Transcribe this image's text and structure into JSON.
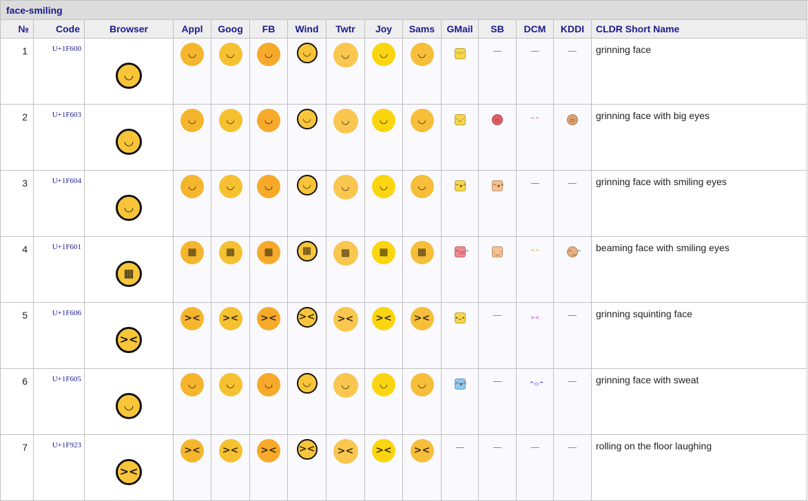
{
  "section_title": "face-smiling",
  "columns": [
    "№",
    "Code",
    "Browser",
    "Appl",
    "Goog",
    "FB",
    "Wind",
    "Twtr",
    "Joy",
    "Sams",
    "GMail",
    "SB",
    "DCM",
    "KDDI",
    "CLDR Short Name"
  ],
  "vendor_colors": {
    "Appl": "#f5b62e",
    "Goog": "#f6c130",
    "FB": "#f7a92a",
    "Wind": "#f8c53a",
    "Twtr": "#f9c64f",
    "Joy": "#fbd50f",
    "Sams": "#f7be3a"
  },
  "rows": [
    {
      "num": "1",
      "code": "U+1F600",
      "glyph": "😀",
      "face": "◡",
      "name": "grinning face",
      "gmail": {
        "present": true,
        "color": "#f7d64a",
        "face": "ᵔᵕᵔ"
      },
      "sb": {
        "present": false
      },
      "dcm": {
        "present": false
      },
      "kddi": {
        "present": false
      }
    },
    {
      "num": "2",
      "code": "U+1F603",
      "glyph": "😃",
      "face": "◡",
      "name": "grinning face with big eyes",
      "gmail": {
        "present": true,
        "color": "#f7d64a",
        "face": "ᵔᴗᵔ"
      },
      "sb": {
        "present": true,
        "color": "#e0606a",
        "face": "▭"
      },
      "dcm": {
        "present": true,
        "color": "#c070f0",
        "face": "^^"
      },
      "kddi": {
        "present": true,
        "color": "#e0a070",
        "face": "▭"
      }
    },
    {
      "num": "3",
      "code": "U+1F604",
      "glyph": "😄",
      "face": "◡",
      "name": "grinning face with smiling eyes",
      "gmail": {
        "present": true,
        "color": "#f7d64a",
        "face": "^▾^"
      },
      "sb": {
        "present": true,
        "color": "#f8c090",
        "face": "^▾^"
      },
      "dcm": {
        "present": false
      },
      "kddi": {
        "present": false
      }
    },
    {
      "num": "4",
      "code": "U+1F601",
      "glyph": "😁",
      "face": "▦",
      "name": "beaming face with smiling eyes",
      "gmail": {
        "present": true,
        "color": "#f08890",
        "face": "^▭^"
      },
      "sb": {
        "present": true,
        "color": "#f8c090",
        "face": "ᵕ‿ᵕ"
      },
      "dcm": {
        "present": true,
        "color": "#f0a020",
        "face": "^^"
      },
      "kddi": {
        "present": true,
        "color": "#e8b080",
        "face": "^‿^"
      }
    },
    {
      "num": "5",
      "code": "U+1F606",
      "glyph": "😆",
      "face": "><",
      "name": "grinning squinting face",
      "gmail": {
        "present": true,
        "color": "#f7d64a",
        "face": "•ᴗ•"
      },
      "sb": {
        "present": false
      },
      "dcm": {
        "present": true,
        "color": "#c070f0",
        "face": "><"
      },
      "kddi": {
        "present": false
      }
    },
    {
      "num": "6",
      "code": "U+1F605",
      "glyph": "😅",
      "face": "◡",
      "name": "grinning face with sweat",
      "gmail": {
        "present": true,
        "color": "#90c8f0",
        "face": "^▾^"
      },
      "sb": {
        "present": false
      },
      "dcm": {
        "present": true,
        "color": "#3030e0",
        "face": "^▭^"
      },
      "kddi": {
        "present": false
      }
    },
    {
      "num": "7",
      "code": "U+1F923",
      "glyph": "🤣",
      "face": "><",
      "name": "rolling on the floor laughing",
      "gmail": {
        "present": false
      },
      "sb": {
        "present": false
      },
      "dcm": {
        "present": false
      },
      "kddi": {
        "present": false
      }
    }
  ]
}
